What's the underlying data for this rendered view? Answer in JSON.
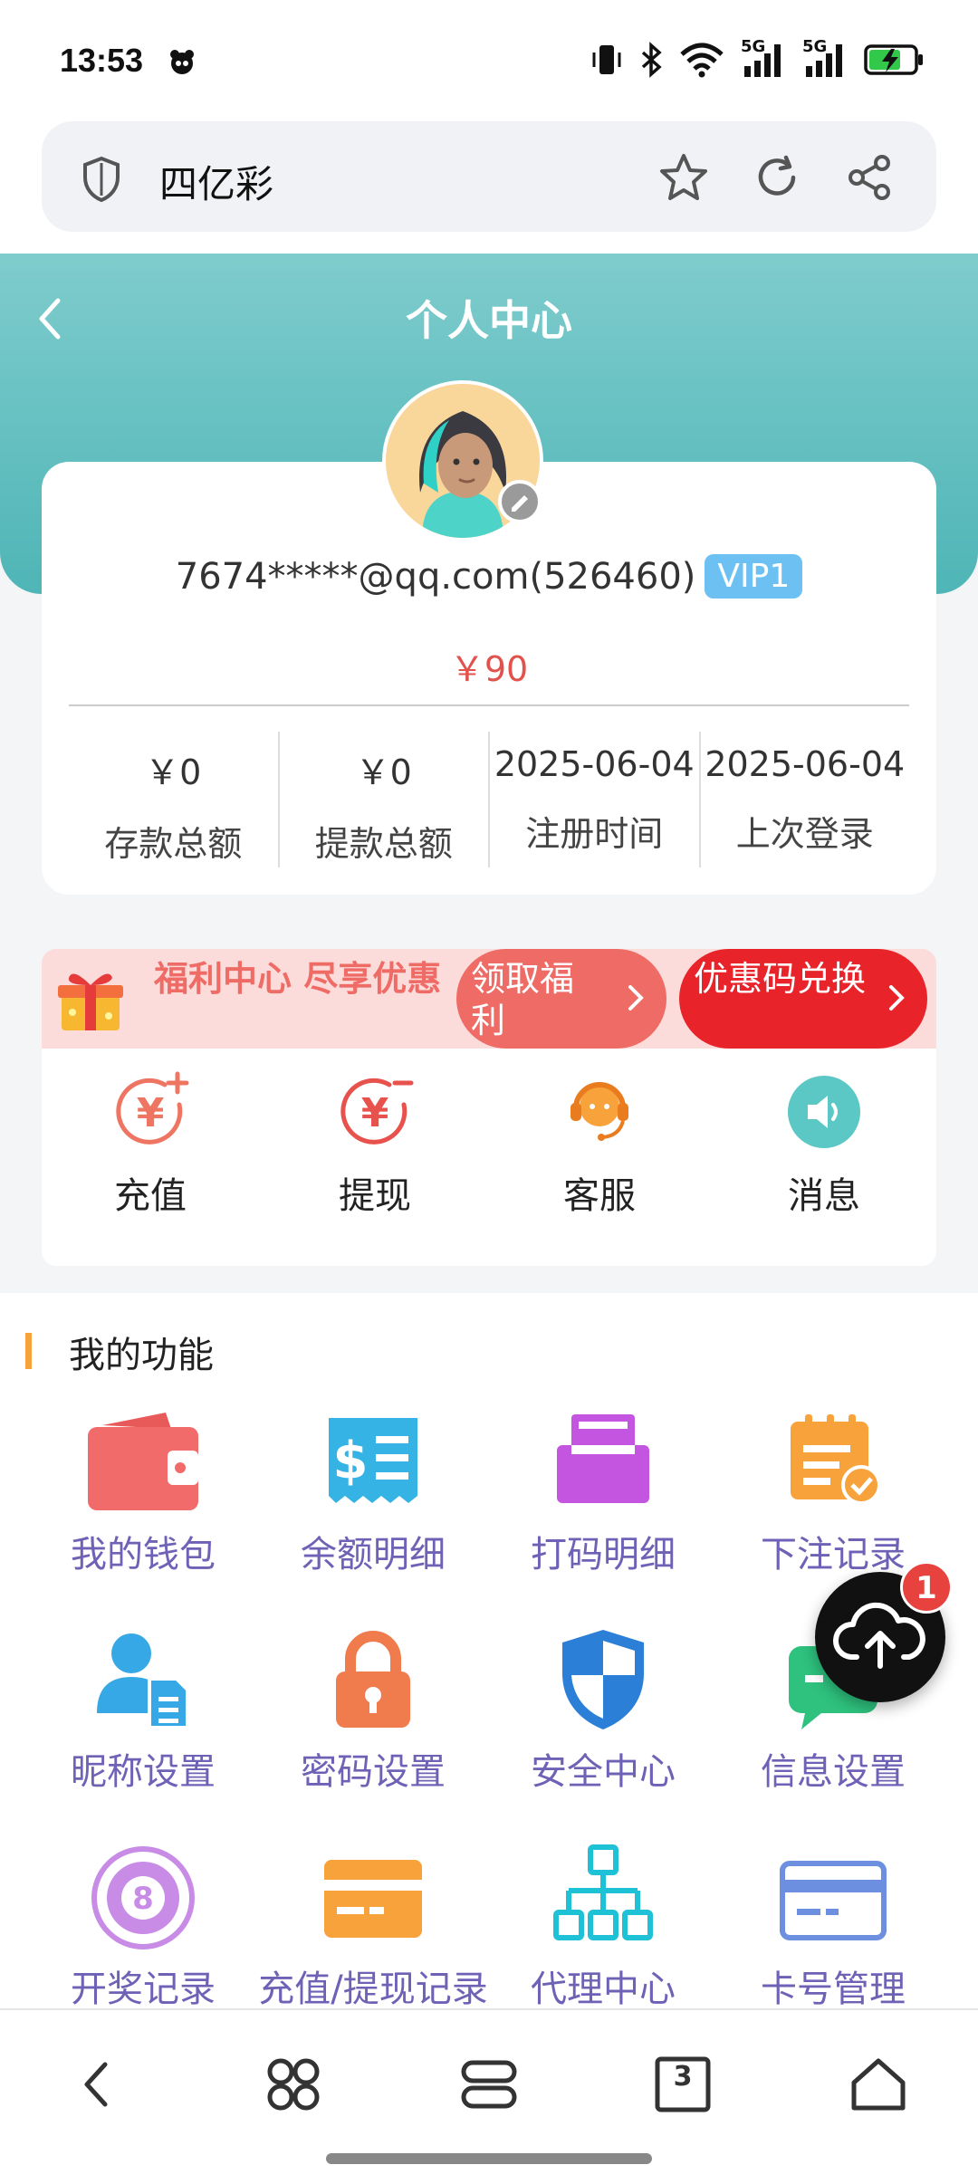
{
  "status_bar": {
    "time": "13:53",
    "network_1": "5G",
    "network_2": "5G"
  },
  "browser": {
    "title": "四亿彩"
  },
  "header": {
    "title": "个人中心"
  },
  "profile": {
    "account": "7674*****@qq.com(526460)",
    "vip": "VIP1",
    "balance": "￥90",
    "stats": [
      {
        "value": "￥0",
        "label": "存款总额"
      },
      {
        "value": "￥0",
        "label": "提款总额"
      },
      {
        "value": "2025-06-04",
        "label": "注册时间"
      },
      {
        "value": "2025-06-04",
        "label": "上次登录"
      }
    ]
  },
  "welfare": {
    "text": "福利中心 尽享优惠",
    "receive_label": "领取福利",
    "coupon_label": "优惠码兑换"
  },
  "quick_actions": [
    {
      "label": "充值",
      "icon": "recharge-icon"
    },
    {
      "label": "提现",
      "icon": "withdraw-icon"
    },
    {
      "label": "客服",
      "icon": "customer-service-icon"
    },
    {
      "label": "消息",
      "icon": "message-icon"
    }
  ],
  "functions": {
    "heading": "我的功能",
    "items": [
      {
        "label": "我的钱包",
        "icon": "wallet-icon"
      },
      {
        "label": "余额明细",
        "icon": "balance-detail-icon"
      },
      {
        "label": "打码明细",
        "icon": "code-detail-icon"
      },
      {
        "label": "下注记录",
        "icon": "bet-record-icon"
      },
      {
        "label": "昵称设置",
        "icon": "nickname-icon"
      },
      {
        "label": "密码设置",
        "icon": "password-lock-icon"
      },
      {
        "label": "安全中心",
        "icon": "security-shield-icon"
      },
      {
        "label": "信息设置",
        "icon": "info-settings-icon"
      },
      {
        "label": "开奖记录",
        "icon": "lottery-ball-icon"
      },
      {
        "label": "充值/提现记录",
        "icon": "recharge-record-icon"
      },
      {
        "label": "代理中心",
        "icon": "agent-tree-icon"
      },
      {
        "label": "卡号管理",
        "icon": "bank-card-icon"
      }
    ]
  },
  "upload_fab": {
    "badge": "1"
  },
  "bottom_nav": {
    "tabs_count": "3"
  }
}
